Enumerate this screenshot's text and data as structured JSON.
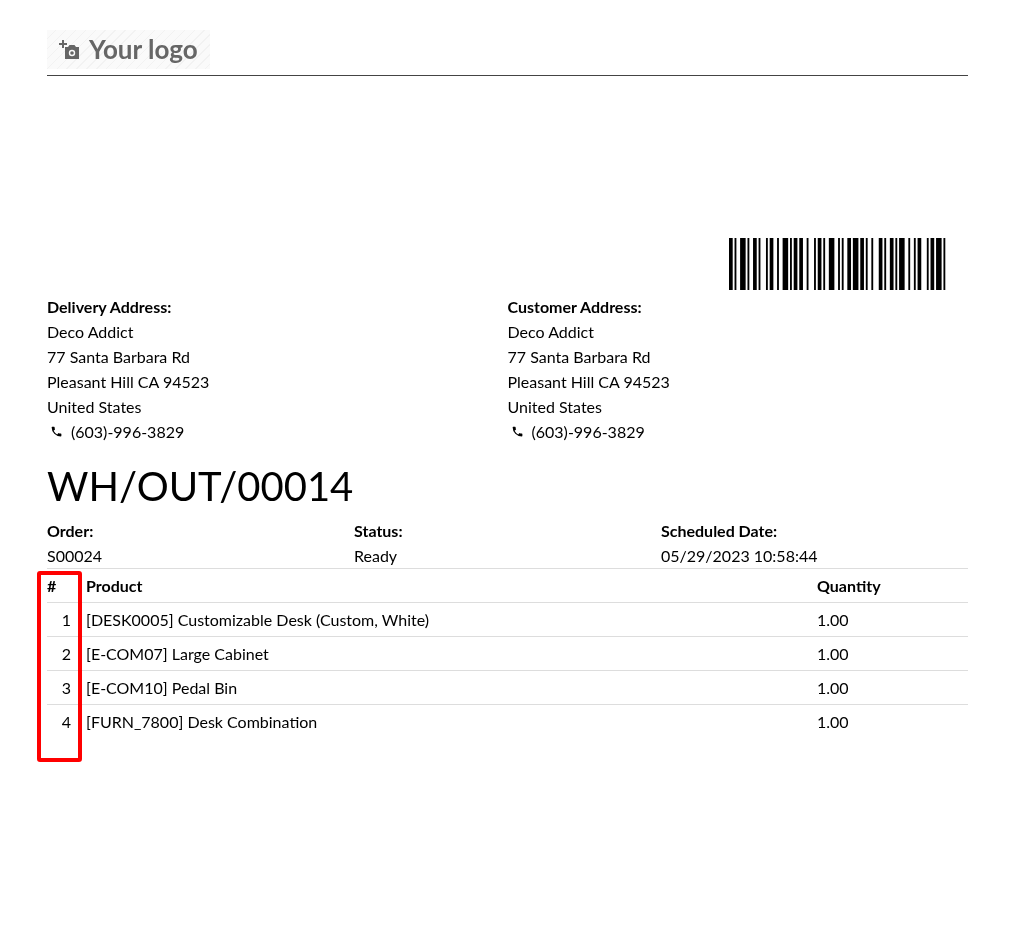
{
  "logo": {
    "text": "Your logo"
  },
  "addresses": [
    {
      "heading": "Delivery Address:",
      "lines": [
        "Deco Addict",
        "77 Santa Barbara Rd",
        "Pleasant Hill CA 94523",
        "United States"
      ],
      "phone": "(603)-996-3829"
    },
    {
      "heading": "Customer Address:",
      "lines": [
        "Deco Addict",
        "77 Santa Barbara Rd",
        "Pleasant Hill CA 94523",
        "United States"
      ],
      "phone": "(603)-996-3829"
    }
  ],
  "title": "WH/OUT/00014",
  "info": [
    {
      "label": "Order:",
      "value": "S00024"
    },
    {
      "label": "Status:",
      "value": "Ready"
    },
    {
      "label": "Scheduled Date:",
      "value": "05/29/2023 10:58:44"
    }
  ],
  "table": {
    "columns": [
      "#",
      "Product",
      "Quantity"
    ],
    "rows": [
      [
        "1",
        "[DESK0005] Customizable Desk (Custom, White)",
        "1.00"
      ],
      [
        "2",
        "[E-COM07] Large Cabinet",
        "1.00"
      ],
      [
        "3",
        "[E-COM10] Pedal Bin",
        "1.00"
      ],
      [
        "4",
        "[FURN_7800] Desk Combination",
        "1.00"
      ]
    ]
  }
}
